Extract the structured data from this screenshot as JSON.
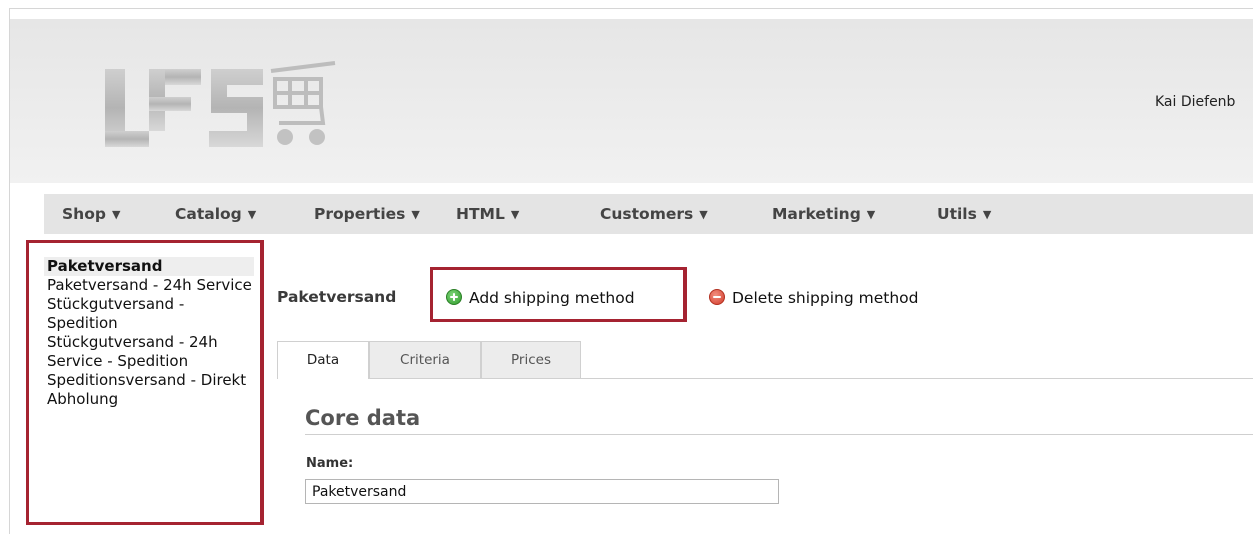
{
  "header": {
    "user_name": "Kai Diefenb",
    "logo_icon": "lfs-shopping-cart-logo"
  },
  "menu": [
    {
      "label": "Shop"
    },
    {
      "label": "Catalog"
    },
    {
      "label": "Properties"
    },
    {
      "label": "HTML"
    },
    {
      "label": "Customers"
    },
    {
      "label": "Marketing"
    },
    {
      "label": "Utils"
    }
  ],
  "menu_arrow": "▼",
  "sidebar": {
    "items": [
      {
        "label": "Paketversand",
        "active": true
      },
      {
        "label": "Paketversand - 24h Service"
      },
      {
        "label": "Stückgutversand - Spedition"
      },
      {
        "label": "Stückgutversand - 24h Service - Spedition"
      },
      {
        "label": "Speditionsversand - Direkt"
      },
      {
        "label": "Abholung"
      }
    ]
  },
  "main": {
    "title": "Paketversand",
    "add_label": "Add shipping method",
    "delete_label": "Delete shipping method",
    "tabs": [
      {
        "label": "Data",
        "active": true
      },
      {
        "label": "Criteria"
      },
      {
        "label": "Prices"
      }
    ],
    "section_title": "Core data",
    "name_label": "Name:",
    "name_value": "Paketversand"
  },
  "colors": {
    "highlight_border": "#a52331",
    "menu_bg": "#e4e4e4",
    "add_icon": "#2e9a2a",
    "delete_icon": "#d23b2b"
  }
}
